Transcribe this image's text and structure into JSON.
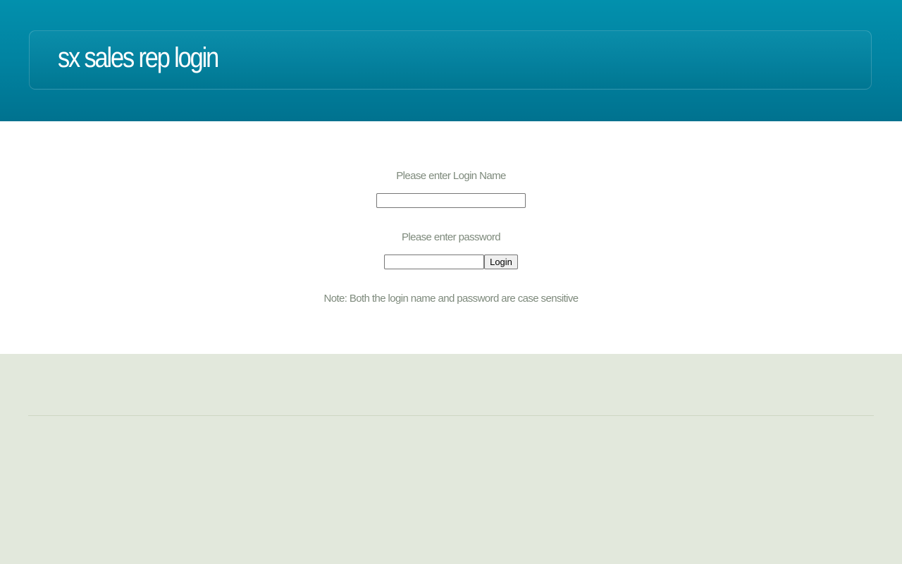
{
  "header": {
    "title": "sx sales rep login"
  },
  "form": {
    "login_label": "Please enter Login Name",
    "login_value": "",
    "password_label": "Please enter password",
    "password_value": "",
    "login_button_label": "Login",
    "note": "Note: Both the login name and password are case sensitive"
  },
  "colors": {
    "header_top": "#0290ad",
    "header_bottom": "#00728f",
    "label_text": "#7e8a7c",
    "footer_background": "#e2e8dc"
  }
}
